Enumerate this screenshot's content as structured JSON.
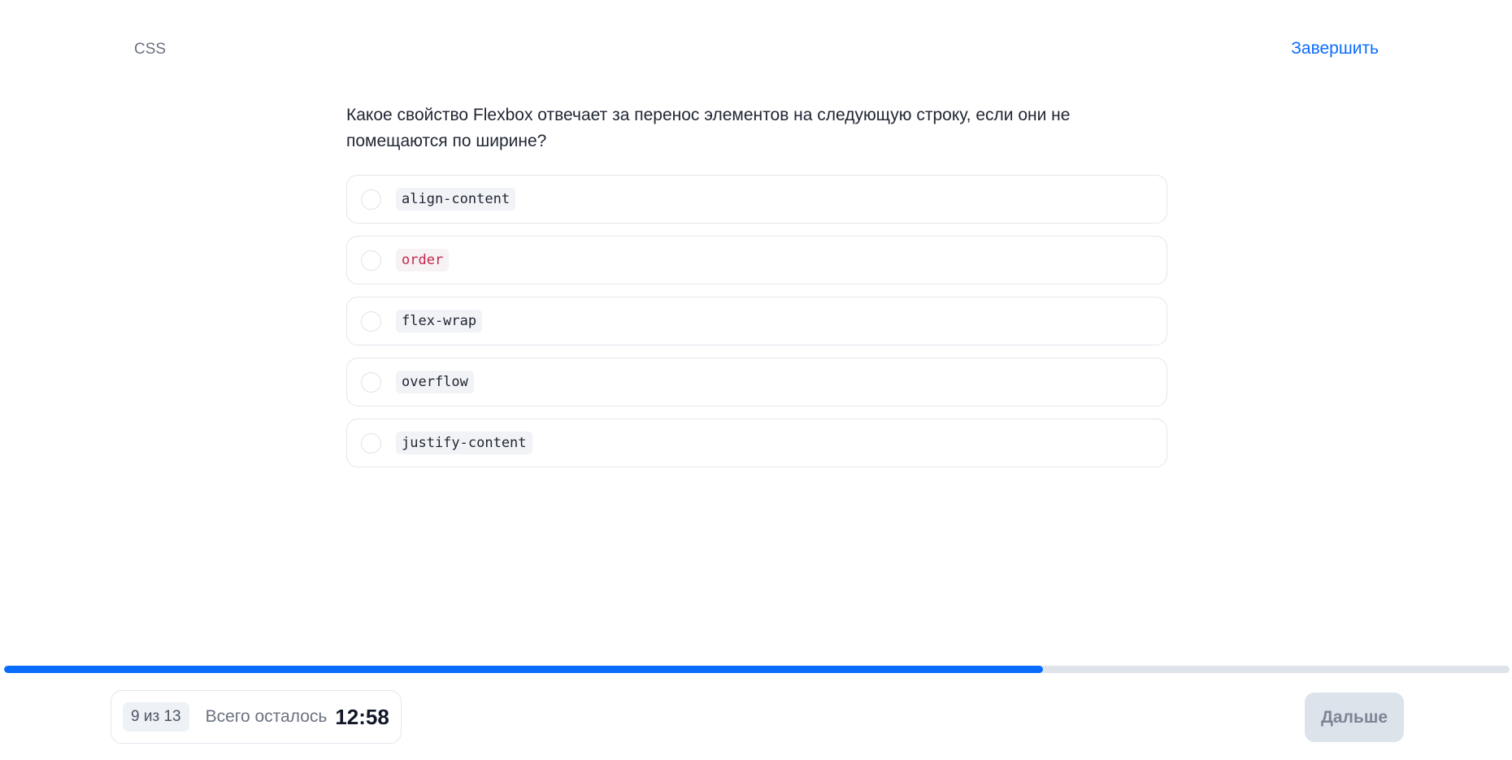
{
  "header": {
    "topic": "CSS",
    "finish_label": "Завершить"
  },
  "question": {
    "text": "Какое свойство Flexbox отвечает за перенос элементов на следующую строку, если они не помещаются по ширине?",
    "options": [
      {
        "label": "align-content",
        "selected": false
      },
      {
        "label": "order",
        "selected": false
      },
      {
        "label": "flex-wrap",
        "selected": false
      },
      {
        "label": "overflow",
        "selected": false
      },
      {
        "label": "justify-content",
        "selected": false
      }
    ]
  },
  "progress": {
    "fraction": 0.69
  },
  "footer": {
    "counter": "9 из 13",
    "remaining_label": "Всего осталось",
    "timer": "12:58",
    "next_label": "Дальше"
  },
  "colors": {
    "accent": "#0a6cff",
    "track": "#dfe4ea",
    "code_accent": "#c7254e",
    "disabled_button_bg": "#dde3ea"
  }
}
